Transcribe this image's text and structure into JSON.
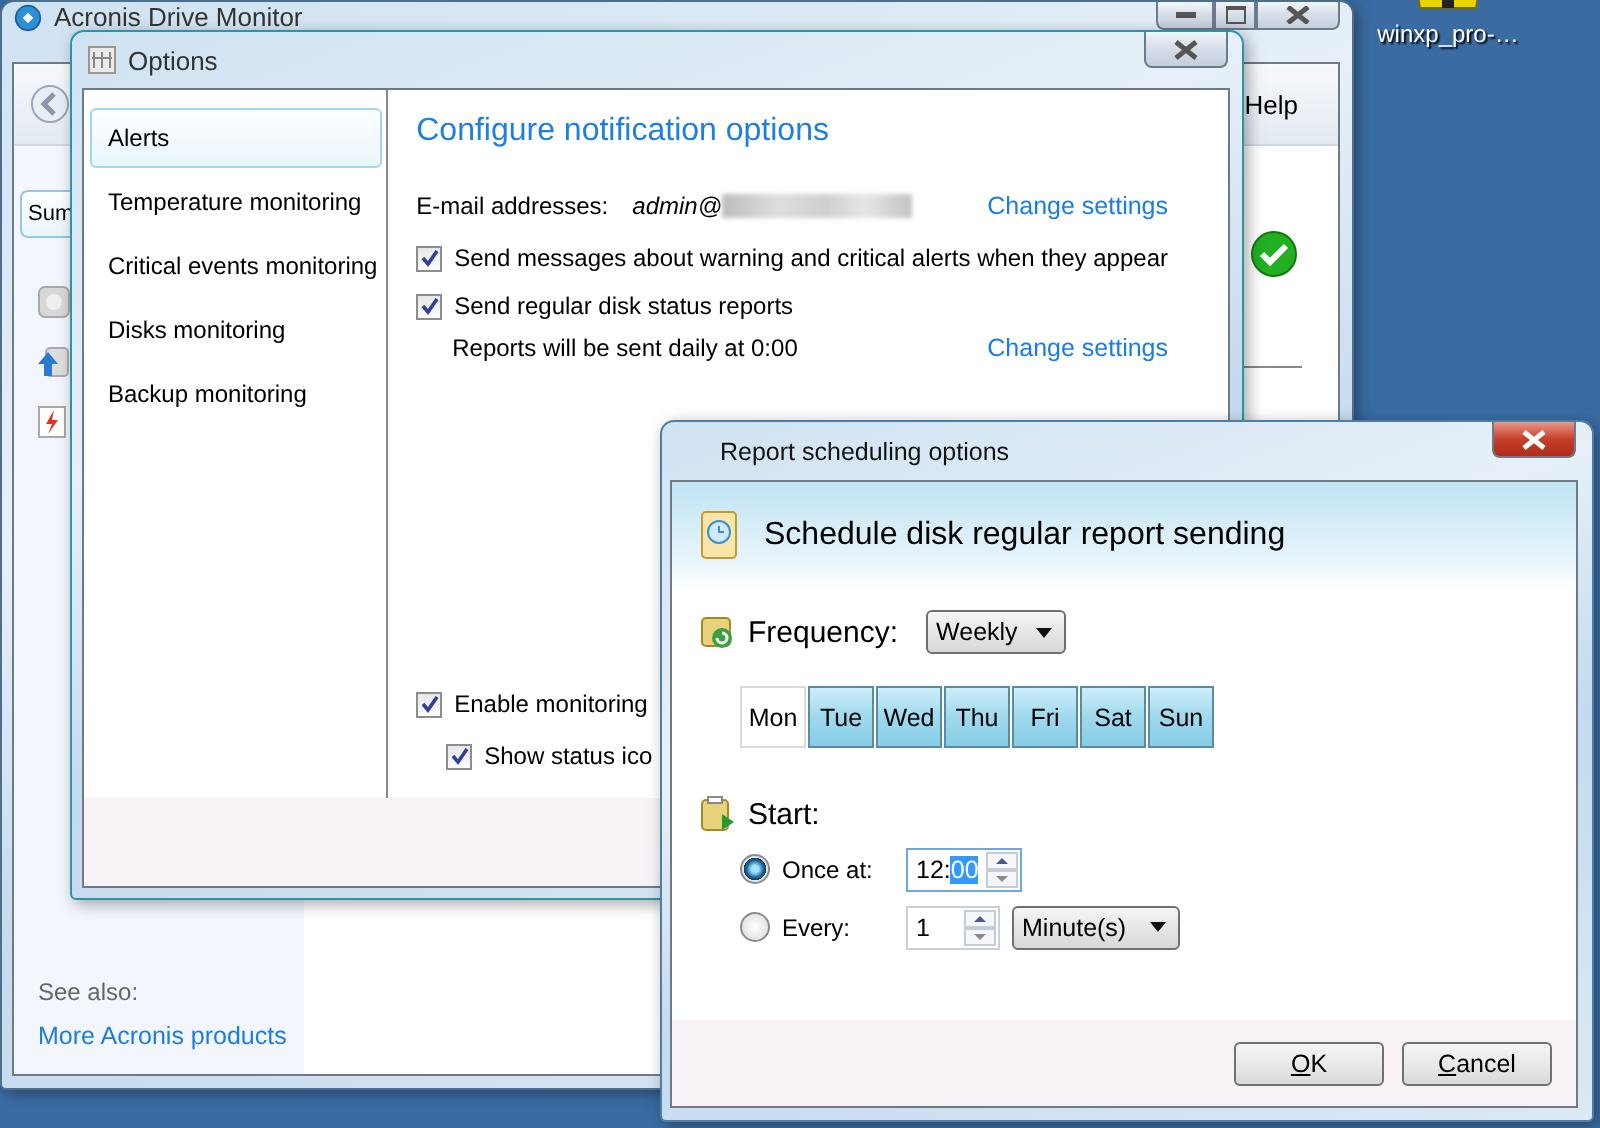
{
  "desktop": {
    "icon": {
      "label": "winxp_pro-…"
    }
  },
  "main_window": {
    "title": "Acronis Drive Monitor",
    "help_button": "Help",
    "tabs": [
      {
        "label": "Sum",
        "selected": true
      }
    ],
    "see_also": {
      "label": "See also:",
      "link": "More Acronis products"
    }
  },
  "options_dialog": {
    "title": "Options",
    "categories": [
      {
        "label": "Alerts",
        "selected": true
      },
      {
        "label": "Temperature monitoring",
        "selected": false
      },
      {
        "label": "Critical events monitoring",
        "selected": false
      },
      {
        "label": "Disks monitoring",
        "selected": false
      },
      {
        "label": "Backup monitoring",
        "selected": false
      }
    ],
    "heading": "Configure notification options",
    "email": {
      "label": "E-mail addresses:",
      "value": "admin@",
      "link": "Change settings"
    },
    "alert_options": [
      {
        "label": "Send messages about warning and critical alerts when they appear",
        "checked": true
      },
      {
        "label": "Send regular disk status reports",
        "checked": true,
        "note": "Reports will be sent daily at 0:00",
        "link": "Change settings"
      }
    ],
    "general_options": [
      {
        "label": "Enable monitoring",
        "checked": true
      },
      {
        "label": "Show status ico",
        "checked": true
      }
    ]
  },
  "report_dialog": {
    "title": "Report scheduling options",
    "heading": "Schedule disk regular report sending",
    "frequency": {
      "label": "Frequency:",
      "value": "Weekly"
    },
    "days": [
      {
        "label": "Mon",
        "selected": false
      },
      {
        "label": "Tue",
        "selected": true
      },
      {
        "label": "Wed",
        "selected": true
      },
      {
        "label": "Thu",
        "selected": true
      },
      {
        "label": "Fri",
        "selected": true
      },
      {
        "label": "Sat",
        "selected": true
      },
      {
        "label": "Sun",
        "selected": true
      }
    ],
    "start": {
      "label": "Start:",
      "choices": [
        {
          "label": "Once at:",
          "selected": true,
          "value": "12:",
          "selected_text": "00"
        },
        {
          "label": "Every:",
          "selected": false,
          "value": "1",
          "unit": "Minute(s)"
        }
      ]
    },
    "buttons": [
      "OK",
      "Cancel"
    ]
  }
}
